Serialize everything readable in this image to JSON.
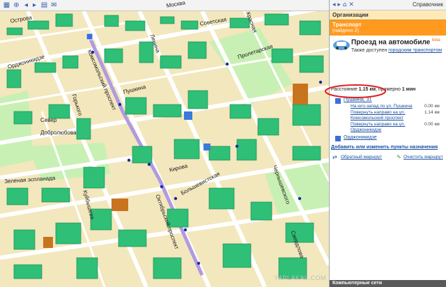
{
  "map": {
    "streets": [
      {
        "id": "ostrova",
        "text": "Острова"
      },
      {
        "id": "moskva",
        "text": "Москва"
      },
      {
        "id": "sovetskaya",
        "text": "Советская"
      },
      {
        "id": "ordzhonikidze",
        "text": "Орджоникидзе"
      },
      {
        "id": "lenin",
        "text": "Ленина"
      },
      {
        "id": "komsomolsky",
        "text": "Комсомольский проспект"
      },
      {
        "id": "pushkina",
        "text": "Пушкина"
      },
      {
        "id": "kirova",
        "text": "Кирова"
      },
      {
        "id": "oktyabrsky",
        "text": "Октябрьский проспект"
      },
      {
        "id": "kuibysheva",
        "text": "Куйбышева"
      },
      {
        "id": "bolshevistskaya",
        "text": "Большевистская"
      },
      {
        "id": "dobrolyubova",
        "text": "Добролюбова"
      },
      {
        "id": "gorkogo",
        "text": "Горького"
      },
      {
        "id": "chernyshevskogo",
        "text": "Чернышевского"
      },
      {
        "id": "sverdlova",
        "text": "Свердлова"
      },
      {
        "id": "zhivopisnaya",
        "text": "Зеленая эспланада"
      },
      {
        "id": "proletarskaya",
        "text": "Пролетарская"
      },
      {
        "id": "krasnaya",
        "text": "Красная"
      },
      {
        "id": "sever",
        "text": "Север"
      }
    ],
    "watermark": "YAPLAKAL.COM",
    "colors": {
      "land": "#f3e7bd",
      "building": "#2fbf77",
      "green": "#c8f0b4",
      "road": "#ffffff",
      "route": "#b09ae0",
      "highlight": "#e02020"
    }
  },
  "panel": {
    "header_title": "Справочник",
    "organizations": "Организации",
    "transport_title": "Транспорт",
    "transport_found": "(найдено 2)",
    "car_title": "Проезд на автомобиле",
    "beta": "beta",
    "also_prefix": "Также доступен",
    "also_link": "городским транспортом",
    "distance_prefix": "Расстояние",
    "distance_value": "1.15 км",
    "time_prefix": "примерно",
    "time_value": "1 мин",
    "origin": "Пушкина, 31",
    "steps": [
      {
        "text": "На юго-запад по ул. Пушкина",
        "km": "0.00 км"
      },
      {
        "text": "Повернуть направо на ул.",
        "km": "1.14 км"
      },
      {
        "text": "Комсомольский проспект",
        "km": ""
      },
      {
        "text": "Повернуть направо на ул.",
        "km": "0.00 км"
      },
      {
        "text": "Орджоникидзе",
        "km": ""
      }
    ],
    "destination": "Орджоникидзе",
    "add_points": "Добавить или изменить пункты назначения",
    "reverse_route": "Обратный маршрут",
    "clear_route": "Очистить маршрут",
    "bottom": "Компьютерные сети"
  }
}
